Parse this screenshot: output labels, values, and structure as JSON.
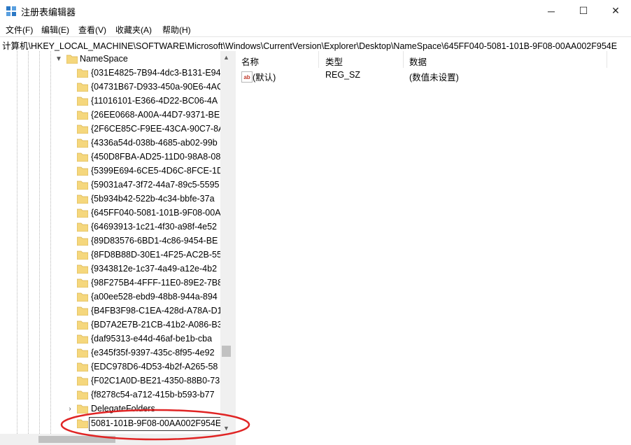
{
  "window": {
    "title": "注册表编辑器",
    "min_glyph": "─",
    "max_glyph": "☐",
    "close_glyph": "✕"
  },
  "menu": [
    "文件(F)",
    "编辑(E)",
    "查看(V)",
    "收藏夹(A)",
    "帮助(H)"
  ],
  "address": "计算机\\HKEY_LOCAL_MACHINE\\SOFTWARE\\Microsoft\\Windows\\CurrentVersion\\Explorer\\Desktop\\NameSpace\\645FF040-5081-101B-9F08-00AA002F954E",
  "tree": {
    "parent": "NameSpace",
    "children": [
      "{031E4825-7B94-4dc3-B131-E94",
      "{04731B67-D933-450a-90E6-4AC",
      "{11016101-E366-4D22-BC06-4A",
      "{26EE0668-A00A-44D7-9371-BE",
      "{2F6CE85C-F9EE-43CA-90C7-8A9",
      "{4336a54d-038b-4685-ab02-99b",
      "{450D8FBA-AD25-11D0-98A8-08",
      "{5399E694-6CE5-4D6C-8FCE-1D",
      "{59031a47-3f72-44a7-89c5-5595",
      "{5b934b42-522b-4c34-bbfe-37a",
      "{645FF040-5081-101B-9F08-00A",
      "{64693913-1c21-4f30-a98f-4e52",
      "{89D83576-6BD1-4c86-9454-BE",
      "{8FD8B88D-30E1-4F25-AC2B-55",
      "{9343812e-1c37-4a49-a12e-4b2",
      "{98F275B4-4FFF-11E0-89E2-7B8",
      "{a00ee528-ebd9-48b8-944a-894",
      "{B4FB3F98-C1EA-428d-A78A-D1",
      "{BD7A2E7B-21CB-41b2-A086-B3",
      "{daf95313-e44d-46af-be1b-cba",
      "{e345f35f-9397-435c-8f95-4e92",
      "{EDC978D6-4D53-4b2f-A265-58",
      "{F02C1A0D-BE21-4350-88B0-73",
      "{f8278c54-a712-415b-b593-b77"
    ],
    "sibling": "DelegateFolders",
    "editing_value": "5081-101B-9F08-00AA002F954E"
  },
  "columns": {
    "name": "名称",
    "type": "类型",
    "data": "数据"
  },
  "values": [
    {
      "name": "(默认)",
      "type": "REG_SZ",
      "data": "(数值未设置)",
      "icon": "ab"
    }
  ],
  "colors": {
    "folder": "#f5d77d",
    "annotation": "#e02424",
    "scrollbar": "#c1c1c1"
  }
}
